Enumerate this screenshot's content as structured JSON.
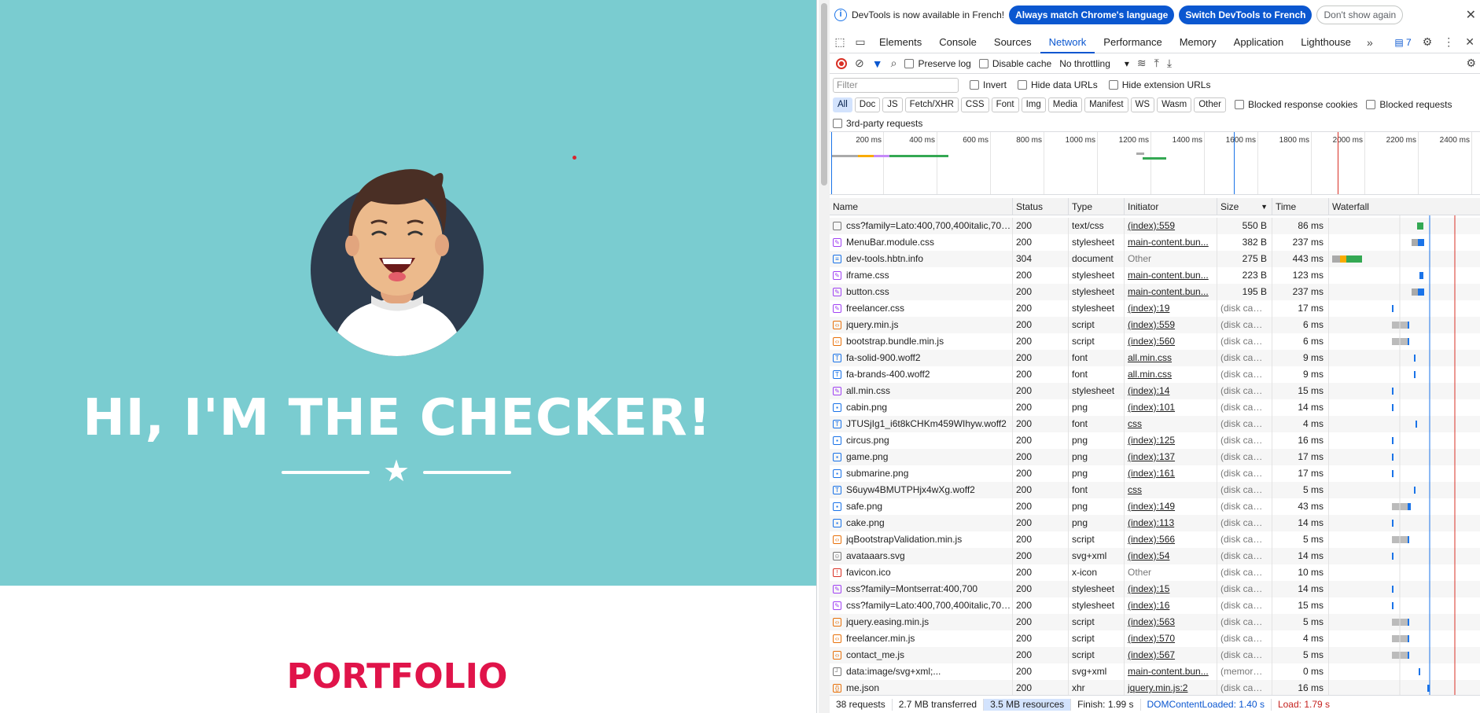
{
  "page": {
    "hero_title": "HI, I'M THE CHECKER!",
    "portfolio_title": "PORTFOLIO",
    "colors": {
      "hero_bg": "#7accd0",
      "portfolio": "#e0144a"
    }
  },
  "devtools": {
    "infobar": {
      "message": "DevTools is now available in French!",
      "btn_match": "Always match Chrome's language",
      "btn_switch": "Switch DevTools to French",
      "btn_dismiss": "Don't show again"
    },
    "tabs": [
      "Elements",
      "Console",
      "Sources",
      "Network",
      "Performance",
      "Memory",
      "Application",
      "Lighthouse"
    ],
    "active_tab": "Network",
    "issues_count": "7",
    "toolbar": {
      "preserve_log": "Preserve log",
      "disable_cache": "Disable cache",
      "throttling": "No throttling"
    },
    "filter": {
      "placeholder": "Filter",
      "invert": "Invert",
      "hide_data": "Hide data URLs",
      "hide_ext": "Hide extension URLs"
    },
    "types": [
      "All",
      "Doc",
      "JS",
      "Fetch/XHR",
      "CSS",
      "Font",
      "Img",
      "Media",
      "Manifest",
      "WS",
      "Wasm",
      "Other"
    ],
    "blocked_cookies": "Blocked response cookies",
    "blocked_requests": "Blocked requests",
    "third_party": "3rd-party requests",
    "overview_ticks": [
      "200 ms",
      "400 ms",
      "600 ms",
      "800 ms",
      "1000 ms",
      "1200 ms",
      "1400 ms",
      "1600 ms",
      "1800 ms",
      "2000 ms",
      "2200 ms",
      "2400 ms"
    ],
    "columns": [
      "Name",
      "Status",
      "Type",
      "Initiator",
      "Size",
      "Time",
      "Waterfall"
    ],
    "rows": [
      {
        "name": "css?family=Lato:400,700,400italic,700i...",
        "status": "200",
        "type": "text/css",
        "initiator": "(index):559",
        "size": "550 B",
        "time": "86 ms",
        "icon": "doc-icon"
      },
      {
        "name": "MenuBar.module.css",
        "status": "200",
        "type": "stylesheet",
        "initiator": "main-content.bun...",
        "size": "382 B",
        "time": "237 ms",
        "icon": "css-icon"
      },
      {
        "name": "dev-tools.hbtn.info",
        "status": "304",
        "type": "document",
        "initiator": "Other",
        "size": "275 B",
        "time": "443 ms",
        "icon": "document-icon"
      },
      {
        "name": "iframe.css",
        "status": "200",
        "type": "stylesheet",
        "initiator": "main-content.bun...",
        "size": "223 B",
        "time": "123 ms",
        "icon": "css-icon"
      },
      {
        "name": "button.css",
        "status": "200",
        "type": "stylesheet",
        "initiator": "main-content.bun...",
        "size": "195 B",
        "time": "237 ms",
        "icon": "css-icon"
      },
      {
        "name": "freelancer.css",
        "status": "200",
        "type": "stylesheet",
        "initiator": "(index):19",
        "size": "(disk cach...",
        "time": "17 ms",
        "icon": "css-icon"
      },
      {
        "name": "jquery.min.js",
        "status": "200",
        "type": "script",
        "initiator": "(index):559",
        "size": "(disk cach...",
        "time": "6 ms",
        "icon": "script-icon"
      },
      {
        "name": "bootstrap.bundle.min.js",
        "status": "200",
        "type": "script",
        "initiator": "(index):560",
        "size": "(disk cach...",
        "time": "6 ms",
        "icon": "script-icon"
      },
      {
        "name": "fa-solid-900.woff2",
        "status": "200",
        "type": "font",
        "initiator": "all.min.css",
        "size": "(disk cach...",
        "time": "9 ms",
        "icon": "font-icon"
      },
      {
        "name": "fa-brands-400.woff2",
        "status": "200",
        "type": "font",
        "initiator": "all.min.css",
        "size": "(disk cach...",
        "time": "9 ms",
        "icon": "font-icon"
      },
      {
        "name": "all.min.css",
        "status": "200",
        "type": "stylesheet",
        "initiator": "(index):14",
        "size": "(disk cach...",
        "time": "15 ms",
        "icon": "css-icon"
      },
      {
        "name": "cabin.png",
        "status": "200",
        "type": "png",
        "initiator": "(index):101",
        "size": "(disk cach...",
        "time": "14 ms",
        "icon": "image-icon"
      },
      {
        "name": "JTUSjIg1_i6t8kCHKm459WIhyw.woff2",
        "status": "200",
        "type": "font",
        "initiator": "css",
        "size": "(disk cach...",
        "time": "4 ms",
        "icon": "font-icon"
      },
      {
        "name": "circus.png",
        "status": "200",
        "type": "png",
        "initiator": "(index):125",
        "size": "(disk cach...",
        "time": "16 ms",
        "icon": "image-icon"
      },
      {
        "name": "game.png",
        "status": "200",
        "type": "png",
        "initiator": "(index):137",
        "size": "(disk cach...",
        "time": "17 ms",
        "icon": "image-icon"
      },
      {
        "name": "submarine.png",
        "status": "200",
        "type": "png",
        "initiator": "(index):161",
        "size": "(disk cach...",
        "time": "17 ms",
        "icon": "image-icon"
      },
      {
        "name": "S6uyw4BMUTPHjx4wXg.woff2",
        "status": "200",
        "type": "font",
        "initiator": "css",
        "size": "(disk cach...",
        "time": "5 ms",
        "icon": "font-icon"
      },
      {
        "name": "safe.png",
        "status": "200",
        "type": "png",
        "initiator": "(index):149",
        "size": "(disk cach...",
        "time": "43 ms",
        "icon": "image-icon"
      },
      {
        "name": "cake.png",
        "status": "200",
        "type": "png",
        "initiator": "(index):113",
        "size": "(disk cach...",
        "time": "14 ms",
        "icon": "image-icon"
      },
      {
        "name": "jqBootstrapValidation.min.js",
        "status": "200",
        "type": "script",
        "initiator": "(index):566",
        "size": "(disk cach...",
        "time": "5 ms",
        "icon": "script-icon"
      },
      {
        "name": "avataaars.svg",
        "status": "200",
        "type": "svg+xml",
        "initiator": "(index):54",
        "size": "(disk cach...",
        "time": "14 ms",
        "icon": "svg-icon"
      },
      {
        "name": "favicon.ico",
        "status": "200",
        "type": "x-icon",
        "initiator": "Other",
        "size": "(disk cach...",
        "time": "10 ms",
        "icon": "favicon-icon"
      },
      {
        "name": "css?family=Montserrat:400,700",
        "status": "200",
        "type": "stylesheet",
        "initiator": "(index):15",
        "size": "(disk cach...",
        "time": "14 ms",
        "icon": "css-icon"
      },
      {
        "name": "css?family=Lato:400,700,400italic,700i...",
        "status": "200",
        "type": "stylesheet",
        "initiator": "(index):16",
        "size": "(disk cach...",
        "time": "15 ms",
        "icon": "css-icon"
      },
      {
        "name": "jquery.easing.min.js",
        "status": "200",
        "type": "script",
        "initiator": "(index):563",
        "size": "(disk cach...",
        "time": "5 ms",
        "icon": "script-icon"
      },
      {
        "name": "freelancer.min.js",
        "status": "200",
        "type": "script",
        "initiator": "(index):570",
        "size": "(disk cach...",
        "time": "4 ms",
        "icon": "script-icon"
      },
      {
        "name": "contact_me.js",
        "status": "200",
        "type": "script",
        "initiator": "(index):567",
        "size": "(disk cach...",
        "time": "5 ms",
        "icon": "script-icon"
      },
      {
        "name": "data:image/svg+xml;...",
        "status": "200",
        "type": "svg+xml",
        "initiator": "main-content.bun...",
        "size": "(memory ...",
        "time": "0 ms",
        "icon": "data-icon"
      },
      {
        "name": "me.json",
        "status": "200",
        "type": "xhr",
        "initiator": "jquery.min.js:2",
        "size": "(disk cach...",
        "time": "16 ms",
        "icon": "xhr-icon"
      }
    ],
    "status": {
      "requests": "38 requests",
      "transferred": "2.7 MB transferred",
      "resources": "3.5 MB resources",
      "finish": "Finish: 1.99 s",
      "dcl": "DOMContentLoaded: 1.40 s",
      "load": "Load: 1.79 s"
    }
  }
}
